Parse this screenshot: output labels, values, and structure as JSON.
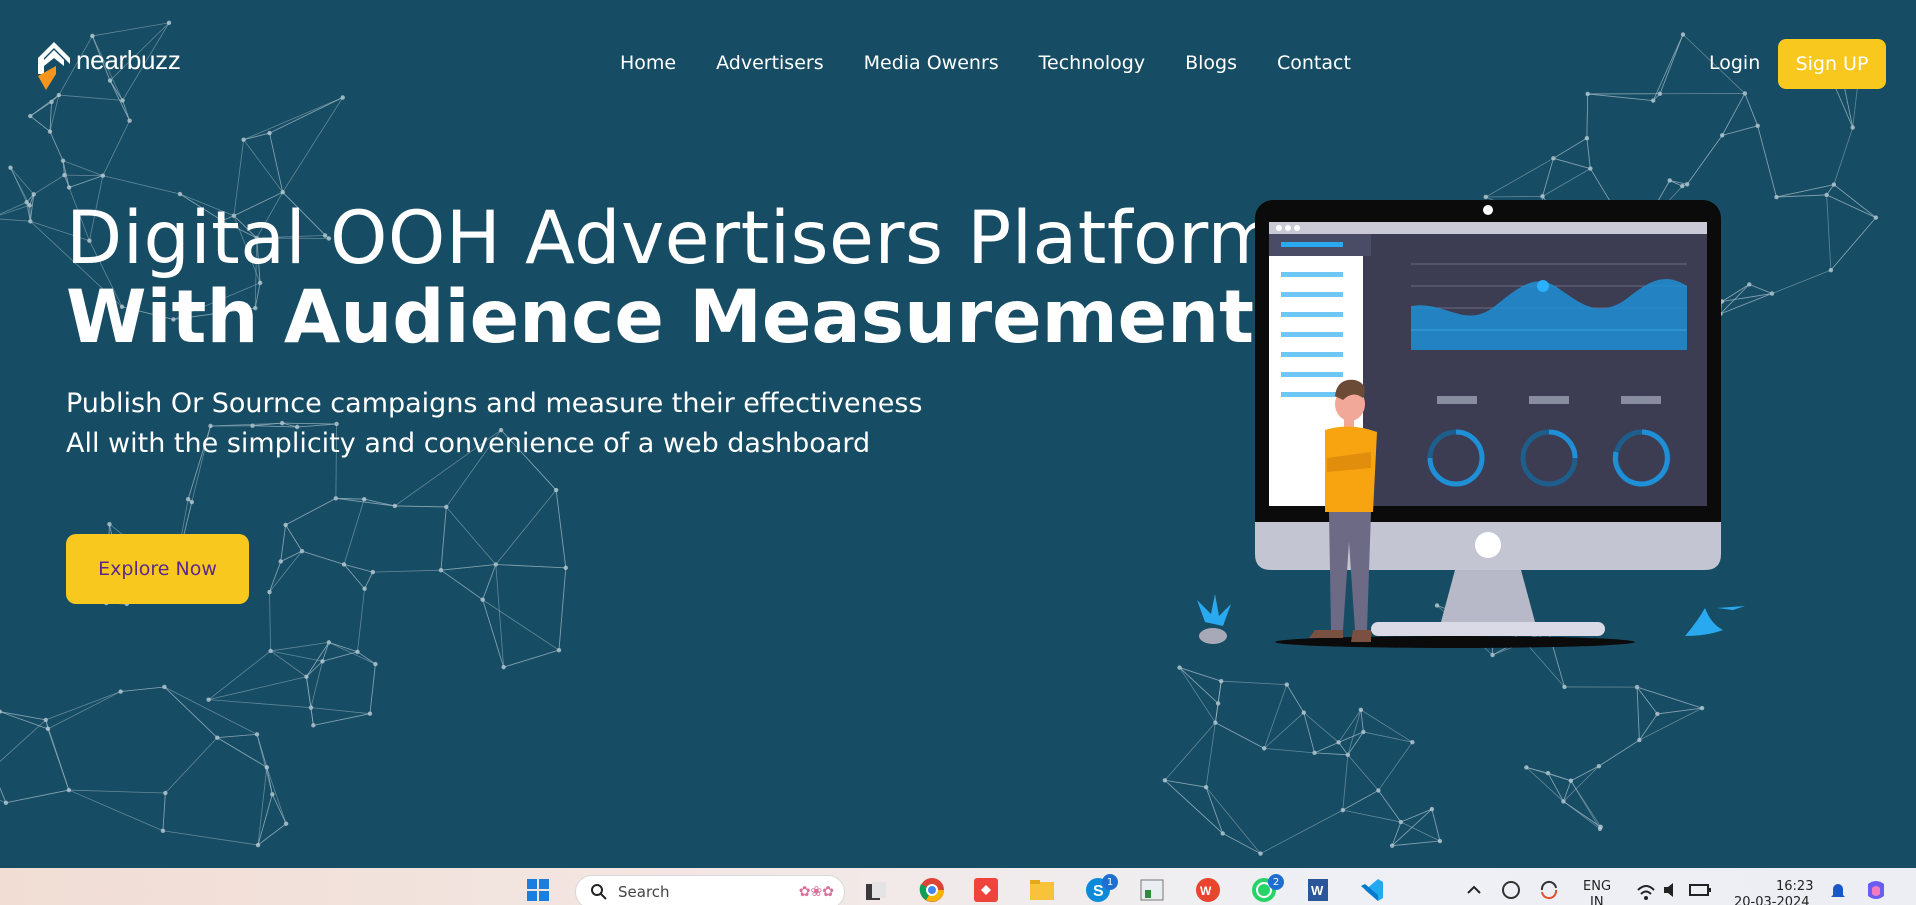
{
  "brand": {
    "name": "nearbuzz"
  },
  "nav": {
    "items": [
      "Home",
      "Advertisers",
      "Media Owenrs",
      "Technology",
      "Blogs",
      "Contact"
    ],
    "login_label": "Login",
    "signup_label": "Sign UP"
  },
  "hero": {
    "title_line1": "Digital OOH Advertisers Platform",
    "title_line2": "With Audience Measurement",
    "subtitle_line1": "Publish Or Sournce campaigns and measure their effectiveness",
    "subtitle_line2": "All with the simplicity and convenience of a web dashboard",
    "cta_label": "Explore Now"
  },
  "taskbar": {
    "search_placeholder": "Search",
    "language": "ENG",
    "language_sub": "IN",
    "time": "16:23",
    "date": "20-03-2024",
    "skype_badge": "1",
    "whatsapp_badge": "2"
  },
  "colors": {
    "background": "#174d64",
    "accent_yellow": "#f9c81e",
    "chart_blue": "#1f8fd6"
  }
}
